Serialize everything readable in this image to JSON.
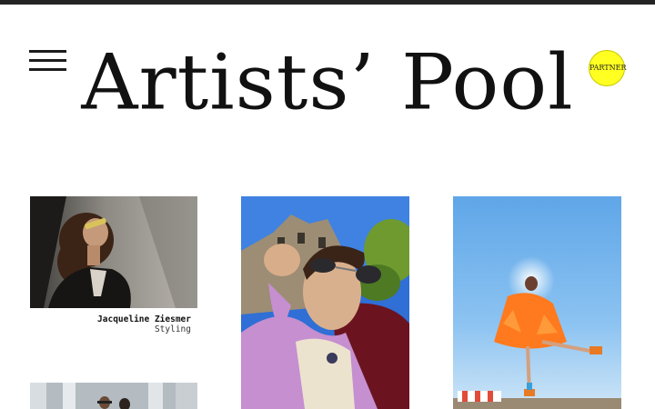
{
  "header": {
    "logo_text": "Artists’ Pool",
    "partner_label": "PARTNER",
    "partner_color": "#ffff22"
  },
  "artists": [
    {
      "name": "Jacqueline Ziesmer",
      "role": "Styling"
    }
  ],
  "icons": {
    "menu": "hamburger-menu-icon"
  }
}
